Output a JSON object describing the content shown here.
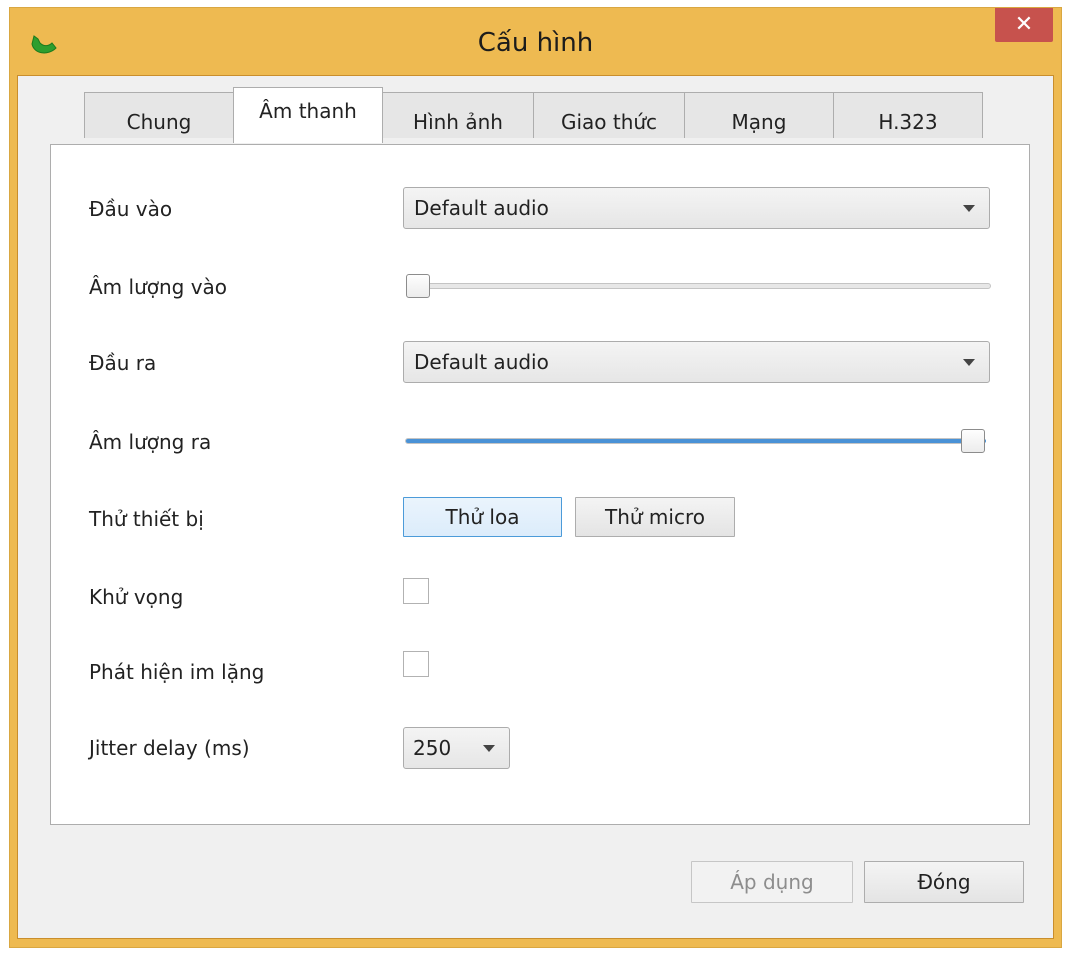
{
  "window": {
    "title": "Cấu hình",
    "app_icon": "phone-icon",
    "close_label": "✕",
    "frame_color": "#eeba51"
  },
  "tabs": [
    {
      "label": "Chung",
      "active": false
    },
    {
      "label": "Âm thanh",
      "active": true
    },
    {
      "label": "Hình ảnh",
      "active": false
    },
    {
      "label": "Giao thức",
      "active": false
    },
    {
      "label": "Mạng",
      "active": false
    },
    {
      "label": "H.323",
      "active": false
    }
  ],
  "audio": {
    "input_label": "Đầu vào",
    "input_value": "Default audio",
    "input_volume_label": "Âm lượng vào",
    "input_volume_level": 0,
    "output_label": "Đầu ra",
    "output_value": "Default audio",
    "output_volume_label": "Âm lượng ra",
    "output_volume_level": 1,
    "test_label": "Thử thiết bị",
    "test_speaker_button": "Thử loa",
    "test_mic_button": "Thử micro",
    "echo_cancel_label": "Khử vọng",
    "echo_cancel_checked": false,
    "silence_detect_label": "Phát hiện im lặng",
    "silence_detect_checked": false,
    "jitter_label": "Jitter delay (ms)",
    "jitter_value": "250"
  },
  "footer": {
    "apply_button": "Áp dụng",
    "close_button": "Đóng"
  },
  "colors": {
    "slider_fill": "#4a92d6",
    "close_button_bg": "#c7524d"
  }
}
